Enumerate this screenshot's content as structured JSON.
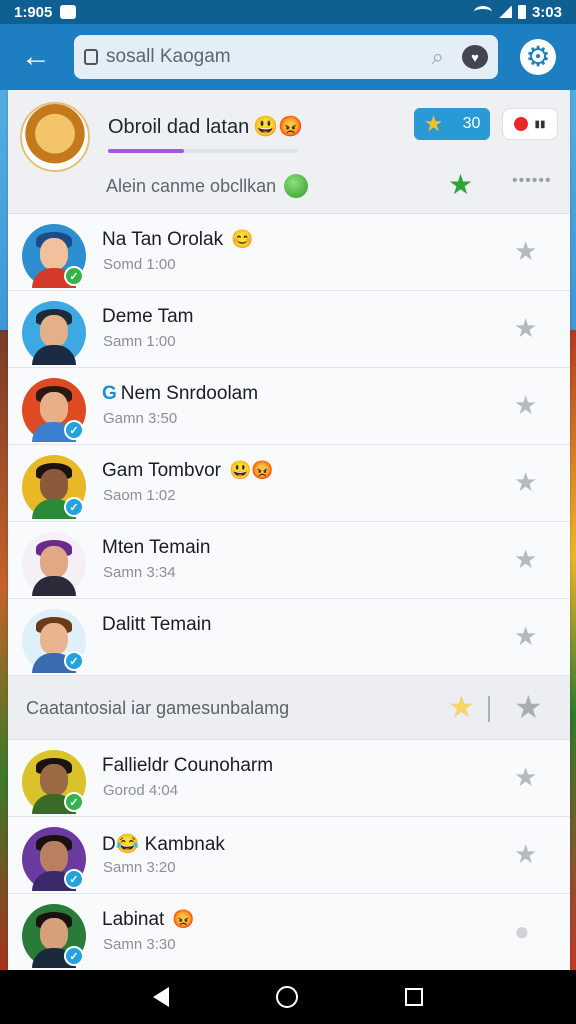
{
  "status_bar": {
    "time_left": "1:905",
    "time_right": "3:03"
  },
  "app_bar": {
    "back_icon": "arrow-left-icon",
    "search_value": "sosall Kaogam",
    "settings_icon": "gear-icon"
  },
  "profile": {
    "name": "Obroil dad latan",
    "name_emoji": "😃😡",
    "progress_fraction": 0.4,
    "subtitle": "Alein canme obcllkan",
    "score": "30",
    "accent": "#a05be2"
  },
  "rows_top": [
    {
      "title": "Na Tan Orolak",
      "emoji": "😊",
      "time": "Somd 1:00",
      "verified": "green",
      "bg": "#2b8fd0",
      "face": "#f2c09a",
      "hair": "#1e4a8a",
      "shirt": "#d33a2a"
    },
    {
      "title": "Deme Tam",
      "emoji": "",
      "time": "Samn 1:00",
      "verified": "none",
      "bg": "#3ca9e2",
      "face": "#e3b08a",
      "hair": "#1c2a3a",
      "shirt": "#1b2a44"
    },
    {
      "title": "Nem Snrdoolam",
      "lead": "G",
      "emoji": "",
      "time": "Gamn 3:50",
      "verified": "blue",
      "bg": "#e04a22",
      "face": "#e8b089",
      "hair": "#2a1a14",
      "shirt": "#3a7fd0"
    },
    {
      "title": "Gam Tombvor",
      "emoji": "😃😡",
      "time": "Saom 1:02",
      "verified": "blue",
      "bg": "#e8b826",
      "face": "#8a5a3a",
      "hair": "#1a120e",
      "shirt": "#2a8a3a"
    },
    {
      "title": "Mten Temain",
      "emoji": "",
      "time": "Samn 3:34",
      "verified": "none",
      "bg": "#f4f0f6",
      "face": "#e0a884",
      "hair": "#6a2a8a",
      "shirt": "#2a2a3a"
    },
    {
      "title": "Dalitt Temain",
      "emoji": "",
      "time": "",
      "verified": "blue",
      "bg": "#dff0fa",
      "face": "#eab48e",
      "hair": "#6a3a1a",
      "shirt": "#3a6ab0"
    }
  ],
  "section": {
    "label": "Caatantosial iar gamesunbalamg"
  },
  "rows_bottom": [
    {
      "title": "Fallieldr Counoharm",
      "emoji": "",
      "time": "Gorod 4:04",
      "verified": "green",
      "bg": "#d9c22a",
      "face": "#9a6a44",
      "hair": "#1a120e",
      "shirt": "#3a6a2a"
    },
    {
      "title": "D😂 Kambnak",
      "emoji": "",
      "time": "Samn 3:20",
      "verified": "blue",
      "bg": "#6a3aa0",
      "face": "#b88060",
      "hair": "#1a120e",
      "shirt": "#3a2a6a"
    },
    {
      "title": "Labinat",
      "emoji": "😡",
      "time": "Samn 3:30",
      "verified": "blue",
      "bg": "#2a7a3a",
      "face": "#d6a07a",
      "hair": "#1a120e",
      "shirt": "#1a2a3a",
      "chat_icon": true
    }
  ],
  "colors": {
    "app_bar": "#1d7fc1",
    "status_bar": "#0f5f93",
    "verified_green": "#35b24a",
    "verified_blue": "#23a2e0"
  }
}
